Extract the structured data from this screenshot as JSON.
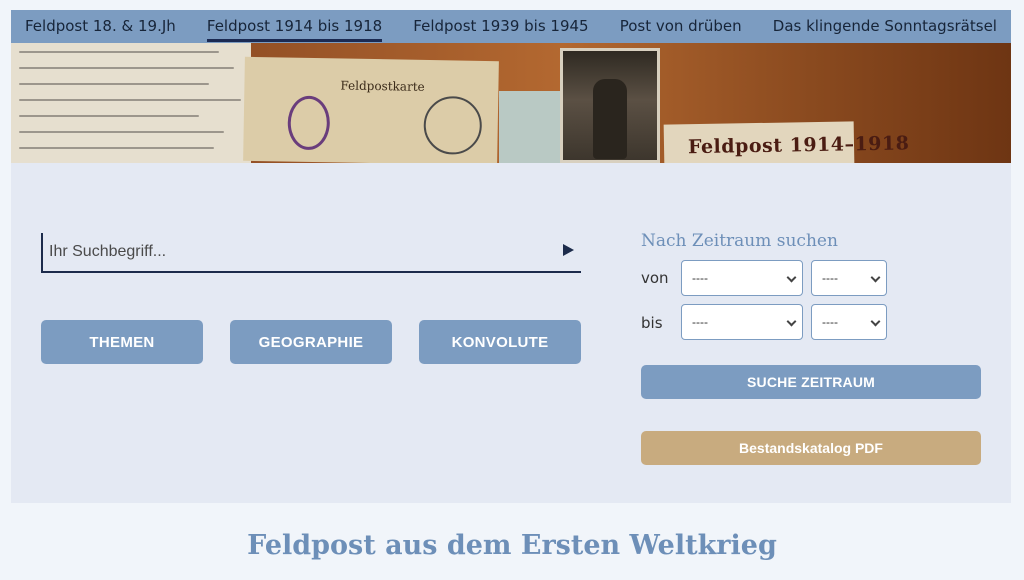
{
  "nav": {
    "items": [
      {
        "label": "Feldpost 18. & 19.Jh"
      },
      {
        "label": "Feldpost 1914 bis 1918",
        "active": true
      },
      {
        "label": "Feldpost 1939 bis 1945"
      },
      {
        "label": "Post von drüben"
      },
      {
        "label": "Das klingende Sonntagsrätsel"
      }
    ]
  },
  "banner": {
    "card_title": "Feldpostkarte",
    "label": "Feldpost 1914–1918"
  },
  "search": {
    "placeholder": "Ihr Suchbegriff...",
    "value": "",
    "submit_icon": "play-triangle-icon"
  },
  "categories": [
    {
      "label": "THEMEN"
    },
    {
      "label": "GEOGRAPHIE"
    },
    {
      "label": "KONVOLUTE"
    }
  ],
  "period": {
    "heading": "Nach Zeitraum suchen",
    "from_label": "von",
    "to_label": "bis",
    "from_select_1": "----",
    "from_select_2": "----",
    "to_select_1": "----",
    "to_select_2": "----",
    "button_label": "SUCHE ZEITRAUM"
  },
  "catalog_button": "Bestandskatalog PDF",
  "headline": "Feldpost aus dem Ersten Weltkrieg",
  "colors": {
    "accent_blue": "#7c9cc1",
    "heading_blue": "#6d8fb8",
    "catalog_gold": "#c8ab7f",
    "nav_underline": "#1b2a52"
  }
}
